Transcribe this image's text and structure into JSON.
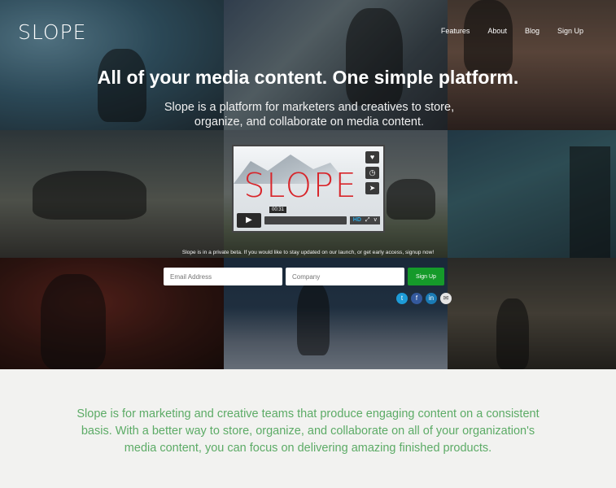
{
  "brand": {
    "logo": "SLOPE"
  },
  "nav": {
    "items": [
      "Features",
      "About",
      "Blog",
      "Sign Up"
    ]
  },
  "hero": {
    "headline": "All of your media content. One simple platform.",
    "subheadline": "Slope is a platform for marketers and creatives to store, organize, and collaborate on media content."
  },
  "video": {
    "title": "SLOPE",
    "timestamp": "00:31",
    "quality_badge": "HD",
    "side_buttons": [
      "heart-icon",
      "clock-icon",
      "send-icon"
    ],
    "controls_icons": [
      "play-icon",
      "fullscreen-icon",
      "vimeo-icon"
    ]
  },
  "signup": {
    "beta_note": "Slope is in a private beta. If you would like to stay updated on our launch, or get early access, signup now!",
    "email_placeholder": "Email Address",
    "company_placeholder": "Company",
    "button_label": "Sign Up",
    "social": [
      {
        "icon": "twitter-icon",
        "glyph": "t"
      },
      {
        "icon": "facebook-icon",
        "glyph": "f"
      },
      {
        "icon": "linkedin-icon",
        "glyph": "in"
      },
      {
        "icon": "email-icon",
        "glyph": "✉"
      }
    ]
  },
  "about": {
    "tagline": "Slope is for marketing and creative teams that produce engaging content on a consistent basis.  With a better way to store, organize, and collaborate on all of your organization's media content, you can focus on delivering amazing finished products."
  },
  "colors": {
    "signup_button": "#159a2a",
    "tagline_text": "#5cab66",
    "video_logo": "#d8262b",
    "page_background": "#f2f2f0"
  }
}
